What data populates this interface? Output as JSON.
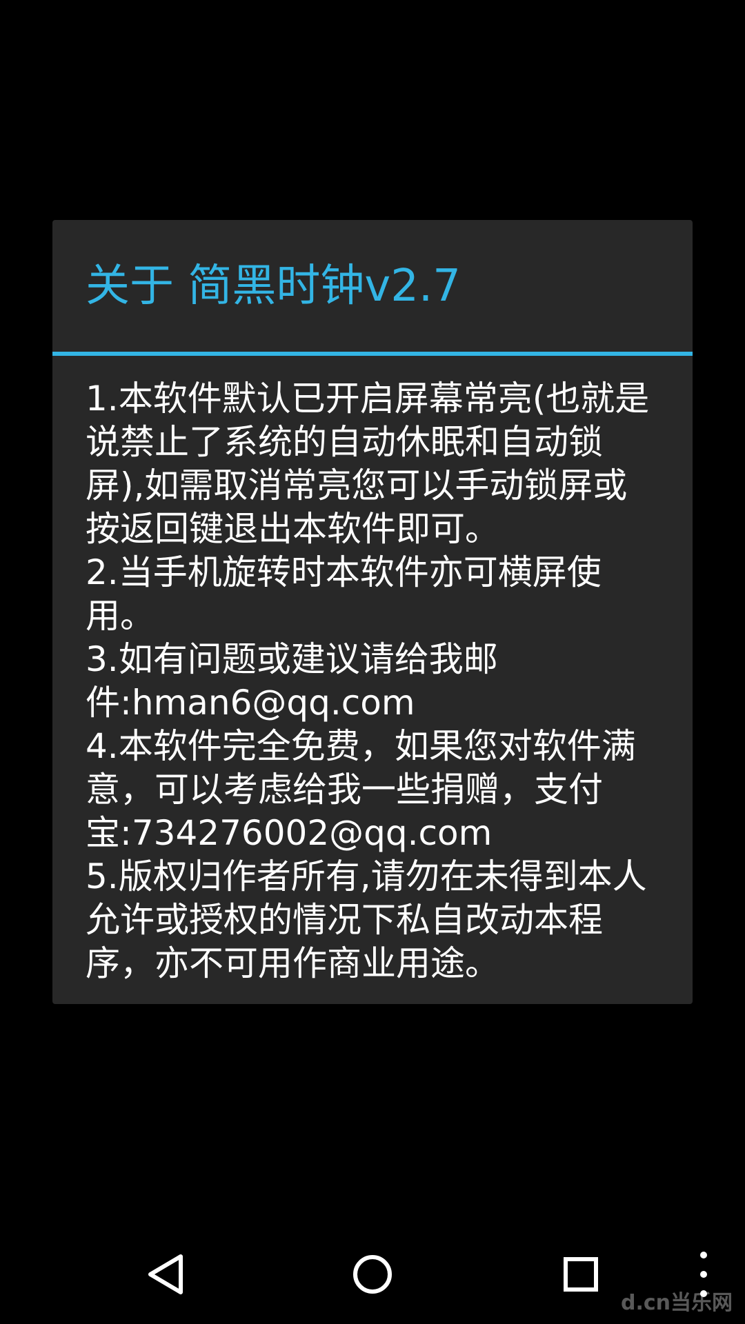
{
  "dialog": {
    "title": "关于 简黑时钟v2.7",
    "accent_color": "#33b5e5",
    "background_color": "#282828",
    "paragraphs": [
      "1.本软件默认已开启屏幕常亮(也就是说禁止了系统的自动休眠和自动锁屏),如需取消常亮您可以手动锁屏或按返回键退出本软件即可。",
      "2.当手机旋转时本软件亦可横屏使用。",
      "3.如有问题或建议请给我邮件:hman6@qq.com",
      "4.本软件完全免费，如果您对软件满意，可以考虑给我一些捐赠，支付宝:734276002@qq.com",
      "5.版权归作者所有,请勿在未得到本人允许或授权的情况下私自改动本程序，亦不可用作商业用途。"
    ]
  },
  "navbar": {
    "back_icon": "back-triangle-icon",
    "home_icon": "home-circle-icon",
    "recent_icon": "recent-apps-square-icon",
    "menu_icon": "overflow-menu-icon"
  },
  "watermark": {
    "text": "d.cn当乐网"
  }
}
